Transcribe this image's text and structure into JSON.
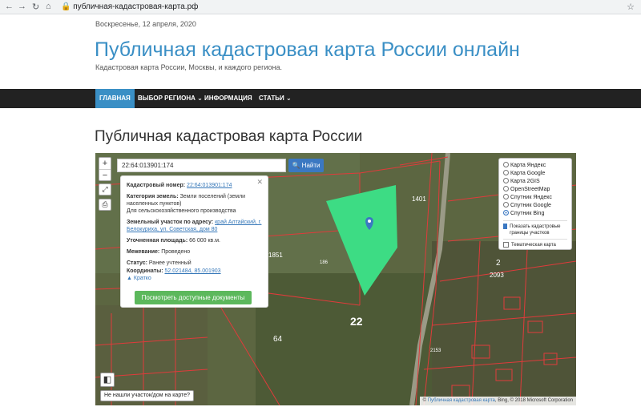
{
  "browser": {
    "url": "публичная-кадастровая-карта.рф"
  },
  "header": {
    "date": "Воскресенье, 12 апреля, 2020",
    "title": "Публичная кадастровая карта России онлайн",
    "subtitle": "Кадастровая карта России, Москвы, и каждого региона."
  },
  "nav": {
    "items": [
      {
        "label": "ГЛАВНАЯ"
      },
      {
        "label": "ВЫБОР РЕГИОНА ⌄"
      },
      {
        "label": "ИНФОРМАЦИЯ"
      },
      {
        "label": "СТАТЬИ ⌄"
      }
    ]
  },
  "page": {
    "heading": "Публичная кадастровая карта России"
  },
  "map": {
    "search_value": "22:64:013901:174",
    "find_label": "🔍 Найти",
    "zoom_in": "+",
    "zoom_out": "−",
    "popup": {
      "cad_label": "Кадастровый номер:",
      "cad_value": "22:64:013901:174",
      "category_label": "Категория земель:",
      "category_value": "Земли поселений (земли населенных пунктов)",
      "category_use": "Для сельскохозяйственного производства",
      "address_label": "Земельный участок по адресу:",
      "address_value": "край Алтайский, г. Белокуриха, ул. Советская, дом 80",
      "area_label": "Уточненная площадь:",
      "area_value": "66 000 кв.м.",
      "survey_label": "Межевание:",
      "survey_value": "Проведено",
      "status_label": "Статус:",
      "status_value": "Ранее учтенный",
      "coords_label": "Координаты:",
      "coords_value": "52.021484, 85.001903",
      "brief": "▲ Кратко",
      "docs_button": "Посмотреть доступные документы",
      "close": "✕"
    },
    "layers": [
      {
        "label": "Карта Яндекс",
        "selected": false
      },
      {
        "label": "Карта Google",
        "selected": false
      },
      {
        "label": "Карта 2GIS",
        "selected": false
      },
      {
        "label": "OpenStreetMap",
        "selected": false
      },
      {
        "label": "Спутник Яндекс",
        "selected": false
      },
      {
        "label": "Спутник Google",
        "selected": false
      },
      {
        "label": "Спутник Bing",
        "selected": true
      }
    ],
    "checks": [
      {
        "label": "Показать кадастровые границы участков",
        "checked": true
      },
      {
        "label": "Тематическая карта",
        "checked": false
      }
    ],
    "not_found": "Не нашли участок/дом на карте?",
    "attribution_prefix": "© ",
    "attribution_link": "Публичная кадастровая карта",
    "attribution_rest": ", Bing, © 2018 Microsoft Corporation",
    "plot_labels": [
      "1401",
      "1851",
      "186",
      "22",
      "64",
      "2",
      "2093",
      "2153"
    ]
  },
  "colors": {
    "accent": "#3a8fc5",
    "nav_bg": "#222222",
    "highlight_plot": "#3ddc84",
    "cad_lines": "#e03b3b",
    "button_green": "#5cb85c"
  }
}
